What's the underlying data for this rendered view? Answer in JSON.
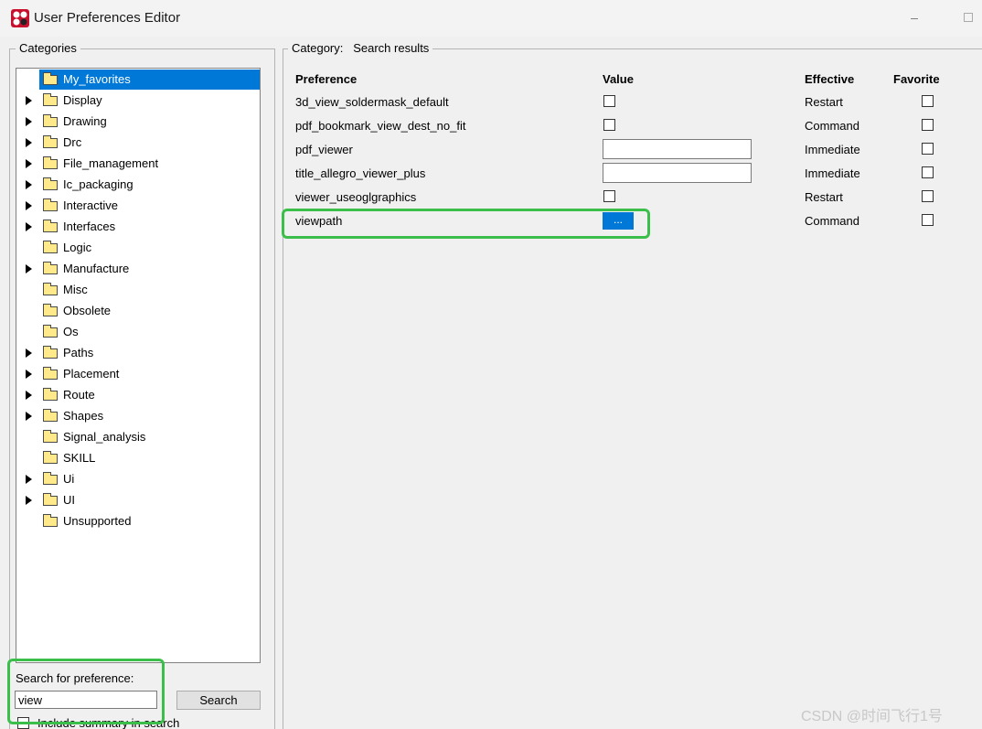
{
  "window": {
    "title": "User Preferences Editor",
    "icon": "app-logo-icon",
    "minimize": "–",
    "maximize": "maximize-icon"
  },
  "categories": {
    "legend": "Categories",
    "items": [
      {
        "label": "My_favorites",
        "expandable": false,
        "selected": true
      },
      {
        "label": "Display",
        "expandable": true
      },
      {
        "label": "Drawing",
        "expandable": true
      },
      {
        "label": "Drc",
        "expandable": true
      },
      {
        "label": "File_management",
        "expandable": true
      },
      {
        "label": "Ic_packaging",
        "expandable": true
      },
      {
        "label": "Interactive",
        "expandable": true
      },
      {
        "label": "Interfaces",
        "expandable": true
      },
      {
        "label": "Logic",
        "expandable": false
      },
      {
        "label": "Manufacture",
        "expandable": true
      },
      {
        "label": "Misc",
        "expandable": false
      },
      {
        "label": "Obsolete",
        "expandable": false
      },
      {
        "label": "Os",
        "expandable": false
      },
      {
        "label": "Paths",
        "expandable": true
      },
      {
        "label": "Placement",
        "expandable": true
      },
      {
        "label": "Route",
        "expandable": true
      },
      {
        "label": "Shapes",
        "expandable": true
      },
      {
        "label": "Signal_analysis",
        "expandable": false
      },
      {
        "label": "SKILL",
        "expandable": false
      },
      {
        "label": "Ui",
        "expandable": true
      },
      {
        "label": "UI",
        "expandable": true
      },
      {
        "label": "Unsupported",
        "expandable": false
      }
    ]
  },
  "search": {
    "label": "Search for preference:",
    "value": "view",
    "button": "Search",
    "summary_label": "Include summary in search"
  },
  "results": {
    "legend_prefix": "Category:",
    "legend_value": "Search results",
    "columns": {
      "preference": "Preference",
      "value": "Value",
      "effective": "Effective",
      "favorite": "Favorite"
    },
    "rows": [
      {
        "name": "3d_view_soldermask_default",
        "value_type": "checkbox",
        "effective": "Restart"
      },
      {
        "name": "pdf_bookmark_view_dest_no_fit",
        "value_type": "checkbox",
        "effective": "Command"
      },
      {
        "name": "pdf_viewer",
        "value_type": "text",
        "effective": "Immediate"
      },
      {
        "name": "title_allegro_viewer_plus",
        "value_type": "text",
        "effective": "Immediate"
      },
      {
        "name": "viewer_useoglgraphics",
        "value_type": "checkbox",
        "effective": "Restart"
      },
      {
        "name": "viewpath",
        "value_type": "button",
        "button_label": "...",
        "effective": "Command"
      }
    ]
  },
  "colors": {
    "selection": "#0078d7",
    "highlight": "#3bbf4a"
  },
  "watermark": "CSDN @时间飞行1号"
}
